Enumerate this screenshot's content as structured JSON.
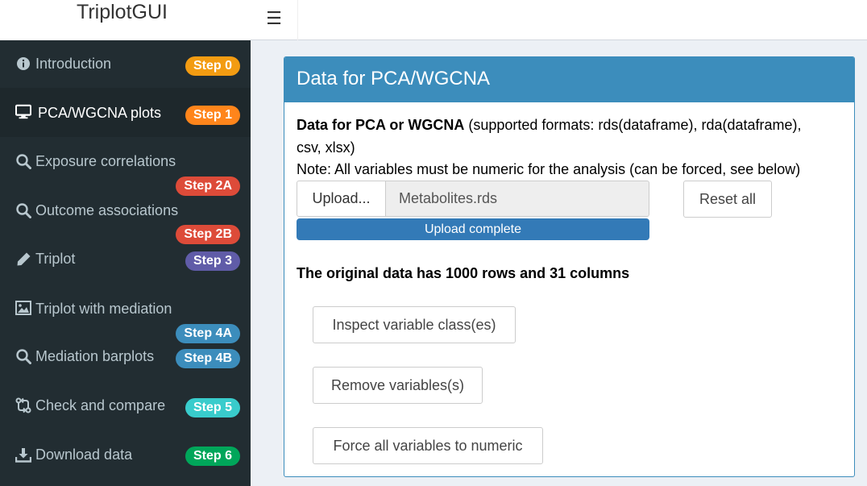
{
  "app": {
    "title": "TriplotGUI"
  },
  "topbar": {
    "toggle_glyph": "☰"
  },
  "sidebar": {
    "items": [
      {
        "label": "Introduction",
        "icon": "info-circle-icon",
        "badge": "Step 0",
        "badge_color": "#f39c12",
        "active": false
      },
      {
        "label": "PCA/WGCNA plots",
        "icon": "desktop-icon",
        "badge": "Step 1",
        "badge_color": "#ff851b",
        "active": true
      },
      {
        "label": "Exposure correlations",
        "icon": "search-icon",
        "badge": "Step 2A",
        "badge_color": "#dd4b39",
        "active": false
      },
      {
        "label": "Outcome associations",
        "icon": "search-icon",
        "badge": "Step 2B",
        "badge_color": "#dd4b39",
        "active": false
      },
      {
        "label": "Triplot",
        "icon": "pencil-icon",
        "badge": "Step 3",
        "badge_color": "#605ca8",
        "active": false
      },
      {
        "label": "Triplot with mediation",
        "icon": "image-icon",
        "badge": "Step 4A",
        "badge_color": "#3c8dbc",
        "active": false
      },
      {
        "label": "Mediation barplots",
        "icon": "search-icon",
        "badge": "Step 4B",
        "badge_color": "#3c8dbc",
        "active": false
      },
      {
        "label": "Check and compare",
        "icon": "compare-icon",
        "badge": "Step 5",
        "badge_color": "#39cccc",
        "active": false
      },
      {
        "label": "Download data",
        "icon": "download-icon",
        "badge": "Step 6",
        "badge_color": "#00a65a",
        "active": false
      }
    ]
  },
  "main": {
    "box_title": "Data for PCA/WGCNA",
    "intro_bold": "Data for PCA or WGCNA",
    "intro_rest": " (supported formats: rds(dataframe), rda(dataframe),",
    "intro_line2": "csv, xlsx)",
    "note": "Note: All variables must be numeric for the analysis (can be forced, see below)",
    "upload_label": "Upload...",
    "file_name": "Metabolites.rds",
    "progress_text": "Upload complete",
    "progress_fraction": 1.0,
    "reset_label": "Reset all",
    "summary": "The original data has 1000 rows and 31 columns",
    "inspect_label": "Inspect variable class(es)",
    "remove_label": "Remove variables(s)",
    "force_label": "Force all variables to numeric"
  }
}
